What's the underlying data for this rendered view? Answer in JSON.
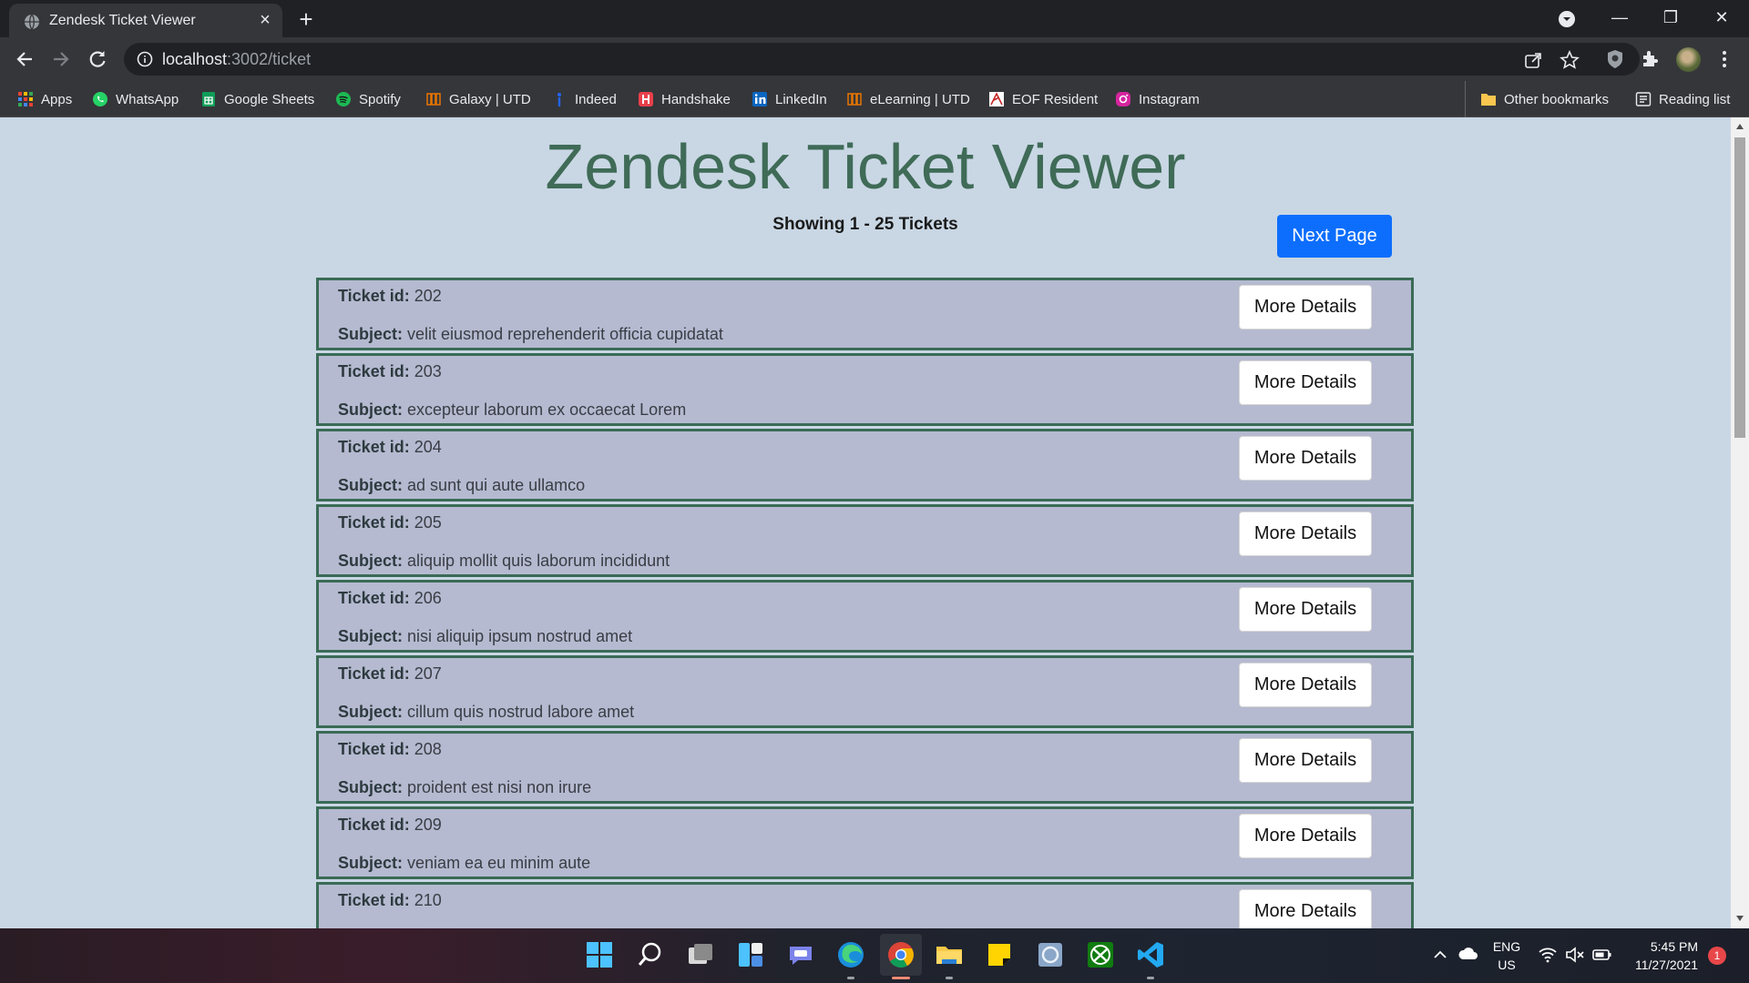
{
  "browser": {
    "tab_title": "Zendesk Ticket Viewer",
    "url_host": "localhost",
    "url_path": ":3002/ticket",
    "bookmarks": [
      {
        "label": "Apps",
        "icon": "apps-grid-icon",
        "color": "#e94235"
      },
      {
        "label": "WhatsApp",
        "icon": "whatsapp-icon",
        "color": "#25d366"
      },
      {
        "label": "Google Sheets",
        "icon": "google-sheets-icon",
        "color": "#0f9d58"
      },
      {
        "label": "Spotify",
        "icon": "spotify-icon",
        "color": "#1db954"
      },
      {
        "label": "Galaxy | UTD",
        "icon": "utd-galaxy-icon",
        "color": "#e87500"
      },
      {
        "label": "Indeed",
        "icon": "indeed-icon",
        "color": "#2164f3"
      },
      {
        "label": "Handshake",
        "icon": "handshake-icon",
        "color": "#e8404b"
      },
      {
        "label": "LinkedIn",
        "icon": "linkedin-icon",
        "color": "#0a66c2"
      },
      {
        "label": "eLearning | UTD",
        "icon": "utd-elearning-icon",
        "color": "#e87500"
      },
      {
        "label": "EOF Resident",
        "icon": "eof-icon",
        "color": "#ffffff"
      },
      {
        "label": "Instagram",
        "icon": "instagram-icon",
        "color": "#d6249f"
      }
    ],
    "other_bookmarks": "Other bookmarks",
    "reading_list": "Reading list"
  },
  "page": {
    "title": "Zendesk Ticket Viewer",
    "showing": "Showing 1 - 25 Tickets",
    "next_button": "Next Page",
    "ticket_id_label": "Ticket id:",
    "subject_label": "Subject:",
    "details_button": "More Details",
    "tickets": [
      {
        "id": "202",
        "subject": "velit eiusmod reprehenderit officia cupidatat"
      },
      {
        "id": "203",
        "subject": "excepteur laborum ex occaecat Lorem"
      },
      {
        "id": "204",
        "subject": "ad sunt qui aute ullamco"
      },
      {
        "id": "205",
        "subject": "aliquip mollit quis laborum incididunt"
      },
      {
        "id": "206",
        "subject": "nisi aliquip ipsum nostrud amet"
      },
      {
        "id": "207",
        "subject": "cillum quis nostrud labore amet"
      },
      {
        "id": "208",
        "subject": "proident est nisi non irure"
      },
      {
        "id": "209",
        "subject": "veniam ea eu minim aute"
      },
      {
        "id": "210",
        "subject": ""
      }
    ],
    "colors": {
      "title": "#3f6b57",
      "background": "#c9d7e4",
      "ticket_bg": "#b5bad0",
      "ticket_border": "#3a6b56",
      "primary": "#0d6efd"
    }
  },
  "taskbar": {
    "apps": [
      "windows-start-icon",
      "search-icon",
      "task-view-icon",
      "widgets-icon",
      "teams-chat-icon",
      "edge-icon",
      "chrome-icon",
      "file-explorer-icon",
      "sticky-notes-icon",
      "photos-icon",
      "xbox-icon",
      "vscode-icon"
    ],
    "lang_top": "ENG",
    "lang_bottom": "US",
    "time": "5:45 PM",
    "date": "11/27/2021",
    "notifications": "1"
  }
}
